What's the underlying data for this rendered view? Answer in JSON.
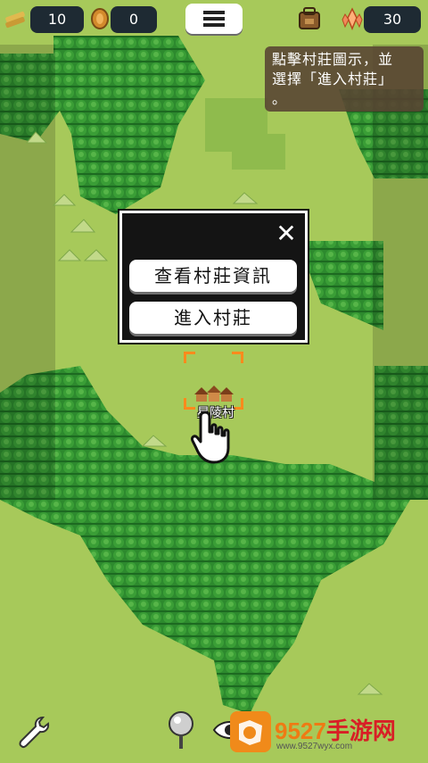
{
  "resources": {
    "wood": {
      "icon": "wood-plank-icon",
      "value": "10"
    },
    "coin": {
      "icon": "coin-icon",
      "value": "0"
    },
    "inventory": {
      "icon": "backpack-icon"
    },
    "crystal": {
      "icon": "crystal-icon",
      "value": "30"
    }
  },
  "hint": {
    "text_line1": "點擊村莊圖示，並",
    "text_line2": "選擇「進入村莊」",
    "text_line3": "。"
  },
  "popup": {
    "close_label": "✕",
    "view_info_label": "查看村莊資訊",
    "enter_village_label": "進入村莊"
  },
  "village": {
    "name": "星陵村"
  },
  "bottom": {
    "wrench_icon": "wrench-icon",
    "pin_icon": "map-pin-icon",
    "eye_icon": "eye-icon"
  },
  "watermark": {
    "brand_num": "9527",
    "brand_cn": "手游网",
    "url": "www.9527wyx.com"
  },
  "colors": {
    "grass": "#a7c95a",
    "forest": "#2f8a2f",
    "forest_dark": "#1f6b22",
    "highlight": "#ff8a1c",
    "hud_bg": "#1e2a33"
  }
}
